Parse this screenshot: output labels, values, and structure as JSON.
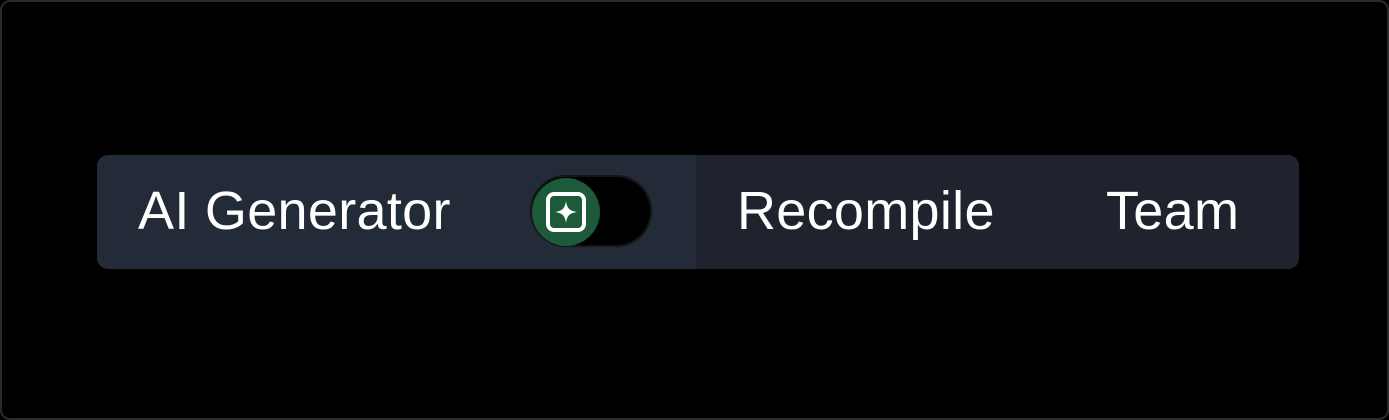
{
  "toolbar": {
    "ai_generator": {
      "label": "AI Generator",
      "toggle_state": "on",
      "toggle_icon": "sparkle-icon",
      "toggle_color": "#1c5a3a"
    },
    "recompile_label": "Recompile",
    "team_label": "Team"
  }
}
